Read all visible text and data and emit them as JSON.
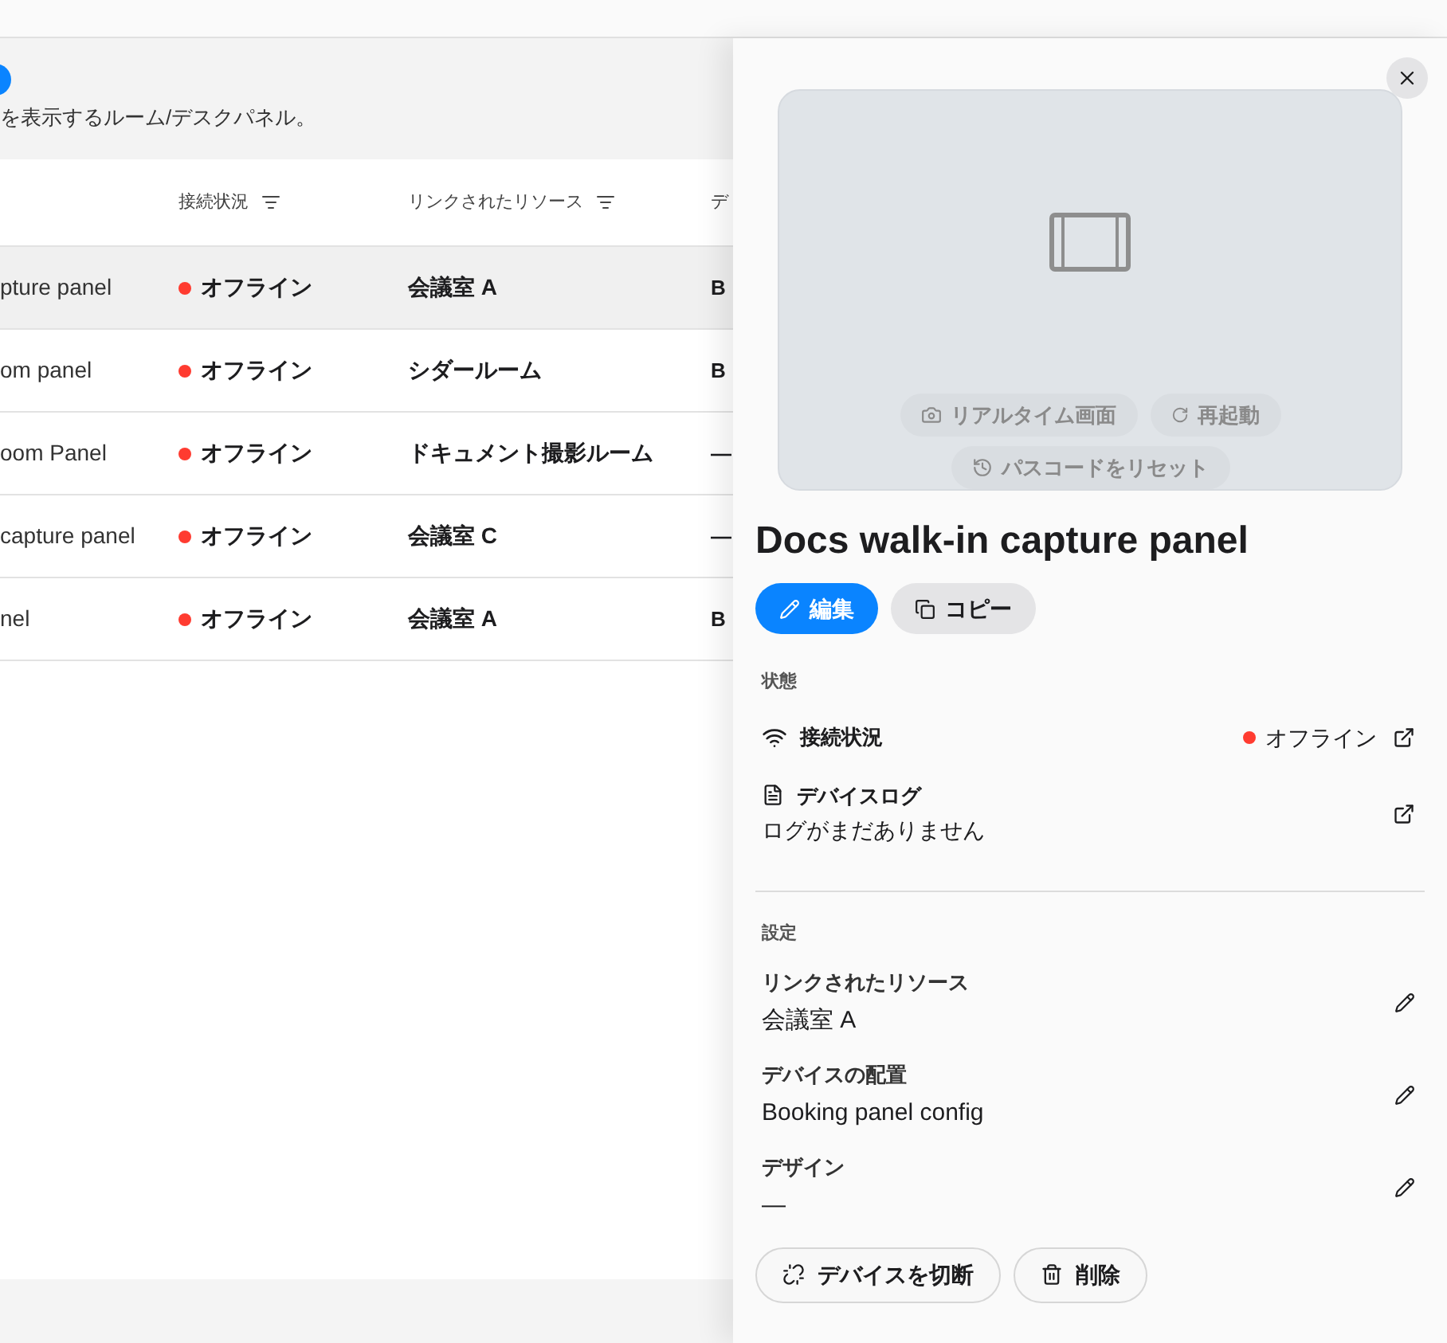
{
  "header": {
    "description": "を表示するルーム/デスクパネル。"
  },
  "table": {
    "columns": [
      "接続状況",
      "リンクされたリソース",
      "デ"
    ],
    "rows": [
      {
        "name": "pture panel",
        "status": "オフライン",
        "color": "#ff3b30",
        "resource": "会議室 A",
        "column_4": "B",
        "selected": true
      },
      {
        "name": "om panel",
        "status": "オフライン",
        "color": "#ff3b30",
        "resource": "シダールーム",
        "column_4": "B",
        "selected": false
      },
      {
        "name": "oom Panel",
        "status": "オフライン",
        "color": "#ff3b30",
        "resource": "ドキュメント撮影ルーム",
        "column_4": "—",
        "selected": false
      },
      {
        "name": "capture panel",
        "status": "オフライン",
        "color": "#ff3b30",
        "resource": "会議室 C",
        "column_4": "—",
        "selected": false
      },
      {
        "name": "nel",
        "status": "オフライン",
        "color": "#ff3b30",
        "resource": "会議室 A",
        "column_4": "B",
        "selected": false
      }
    ]
  },
  "detail": {
    "preview_actions": [
      {
        "label": "リアルタイム画面",
        "kind": "camera"
      },
      {
        "label": "再起動",
        "kind": "restart"
      },
      {
        "label": "パスコードをリセット",
        "kind": "reset"
      }
    ],
    "title": "Docs walk-in capture panel",
    "buttons": [
      {
        "label": "編集",
        "kind": "edit"
      },
      {
        "label": "コピー",
        "kind": "copy"
      }
    ],
    "status_section": {
      "heading": "状態",
      "connection": {
        "label": "接続状況",
        "value": "オフライン",
        "color": "#ff3b30"
      },
      "log": {
        "label": "デバイスログ",
        "value": "ログがまだありません"
      }
    },
    "settings_section": {
      "heading": "設定",
      "items": [
        {
          "label": "リンクされたリソース",
          "value": "会議室 A"
        },
        {
          "label": "デバイスの配置",
          "value": "Booking panel config"
        },
        {
          "label": "デザイン",
          "value": "—"
        }
      ]
    },
    "footer_buttons": [
      {
        "label": "デバイスを切断",
        "kind": "disconnect"
      },
      {
        "label": "削除",
        "kind": "delete"
      }
    ]
  }
}
